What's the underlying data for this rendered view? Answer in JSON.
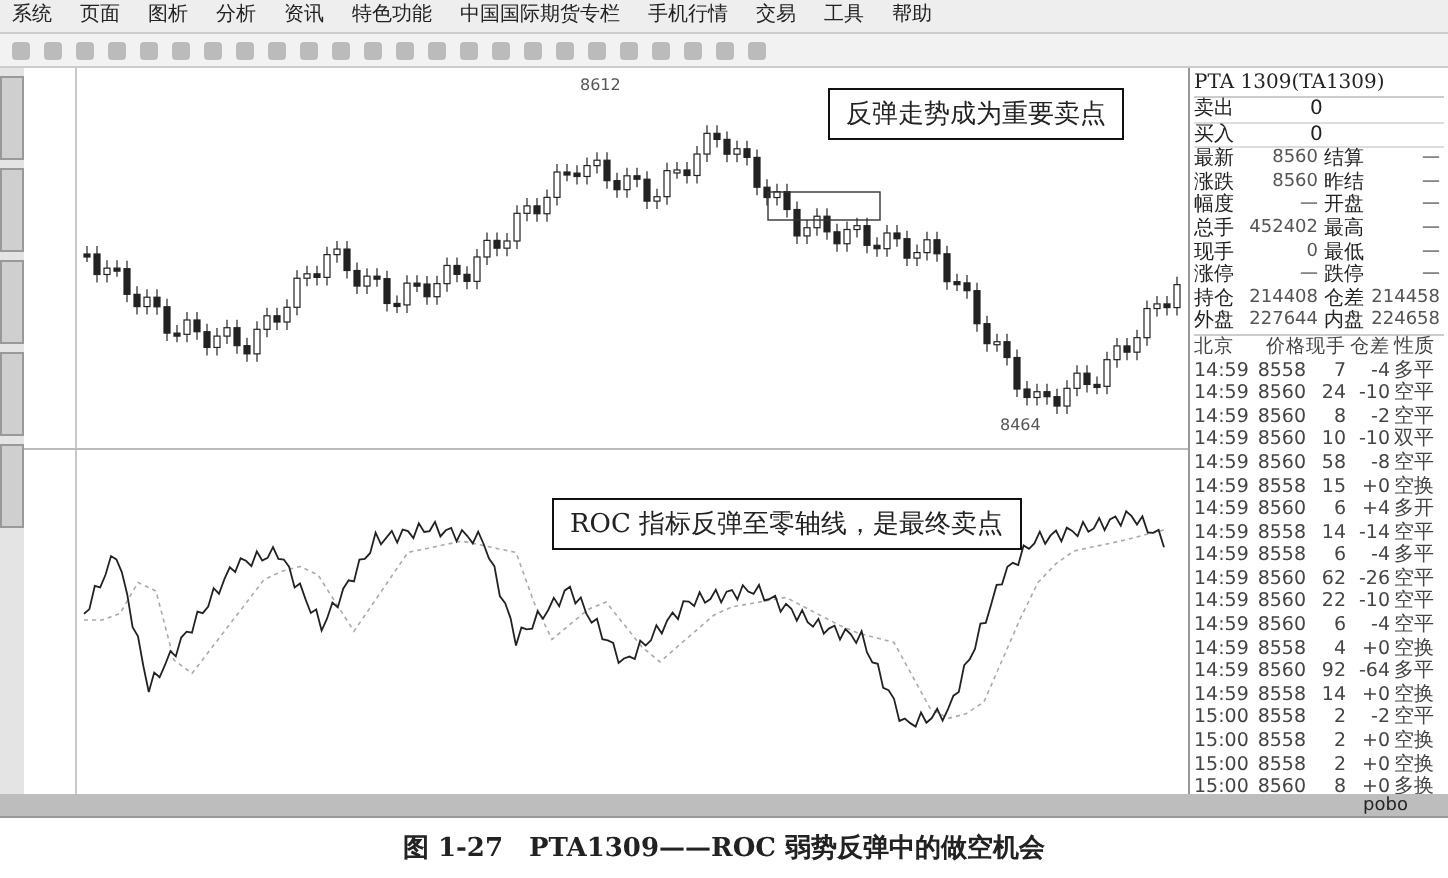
{
  "menu": [
    "系统",
    "页面",
    "图析",
    "分析",
    "资讯",
    "特色功能",
    "中国国际期货专栏",
    "手机行情",
    "交易",
    "工具",
    "帮助"
  ],
  "chart": {
    "header": "PTA 1309(TA1309)",
    "high_label": "8612",
    "low_label": "8464",
    "callout": "反弹走势成为重要卖点"
  },
  "indicator": {
    "callout": "ROC 指标反弹至零轴线，是最终卖点"
  },
  "quote": {
    "orders": [
      {
        "label": "卖出",
        "value": "0"
      },
      {
        "label": "买入",
        "value": "0"
      }
    ],
    "stats": [
      {
        "label": "最新",
        "value": "8560",
        "label2": "结算",
        "value2": "—"
      },
      {
        "label": "涨跌",
        "value": "8560",
        "label2": "昨结",
        "value2": "—"
      },
      {
        "label": "幅度",
        "value": "—",
        "label2": "开盘",
        "value2": "—"
      },
      {
        "label": "总手",
        "value": "452402",
        "label2": "最高",
        "value2": "—"
      },
      {
        "label": "现手",
        "value": "0",
        "label2": "最低",
        "value2": "—"
      },
      {
        "label": "涨停",
        "value": "—",
        "label2": "跌停",
        "value2": "—"
      },
      {
        "label": "持仓",
        "value": "214408",
        "label2": "仓差",
        "value2": "214458"
      },
      {
        "label": "外盘",
        "value": "227644",
        "label2": "内盘",
        "value2": "224658"
      }
    ]
  },
  "ticks": {
    "columns": [
      "北京",
      "价格",
      "现手",
      "仓差",
      "性质"
    ],
    "rows": [
      [
        "14:59",
        "8558",
        "7",
        "-4",
        "多平"
      ],
      [
        "14:59",
        "8560",
        "24",
        "-10",
        "空平"
      ],
      [
        "14:59",
        "8560",
        "8",
        "-2",
        "空平"
      ],
      [
        "14:59",
        "8560",
        "10",
        "-10",
        "双平"
      ],
      [
        "14:59",
        "8560",
        "58",
        "-8",
        "空平"
      ],
      [
        "14:59",
        "8558",
        "15",
        "+0",
        "空换"
      ],
      [
        "14:59",
        "8560",
        "6",
        "+4",
        "多开"
      ],
      [
        "14:59",
        "8558",
        "14",
        "-14",
        "空平"
      ],
      [
        "14:59",
        "8558",
        "6",
        "-4",
        "多平"
      ],
      [
        "14:59",
        "8560",
        "62",
        "-26",
        "空平"
      ],
      [
        "14:59",
        "8560",
        "22",
        "-10",
        "空平"
      ],
      [
        "14:59",
        "8560",
        "6",
        "-4",
        "空平"
      ],
      [
        "14:59",
        "8558",
        "4",
        "+0",
        "空换"
      ],
      [
        "14:59",
        "8560",
        "92",
        "-64",
        "多平"
      ],
      [
        "14:59",
        "8558",
        "14",
        "+0",
        "空换"
      ],
      [
        "15:00",
        "8558",
        "2",
        "-2",
        "空平"
      ],
      [
        "15:00",
        "8558",
        "2",
        "+0",
        "空换"
      ],
      [
        "15:00",
        "8558",
        "2",
        "+0",
        "空换"
      ],
      [
        "15:00",
        "8560",
        "8",
        "+0",
        "多换"
      ]
    ]
  },
  "status_bar": {
    "right": "pobo"
  },
  "caption": "图 1-27　PTA1309——ROC 弱势反弹中的做空机会"
}
